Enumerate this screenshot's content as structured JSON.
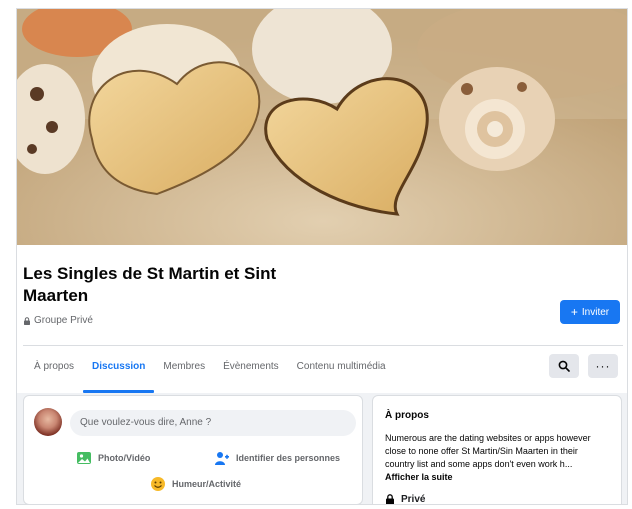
{
  "group": {
    "name": "Les Singles de St Martin et Sint Maarten",
    "privacy": "Groupe Privé",
    "invite_label": "Inviter"
  },
  "tabs": [
    {
      "label": "À propos"
    },
    {
      "label": "Discussion",
      "active": true
    },
    {
      "label": "Membres"
    },
    {
      "label": "Évènements"
    },
    {
      "label": "Contenu multimédia"
    }
  ],
  "more_glyph": "···",
  "composer": {
    "placeholder": "Que voulez-vous dire, Anne ?",
    "actions": {
      "photo": "Photo/Vidéo",
      "tag": "Identifier des personnes",
      "mood": "Humeur/Activité"
    }
  },
  "about": {
    "title": "À propos",
    "description": "Numerous are the dating websites or apps however close to none offer St Martin/Sin Maarten in their country list and some apps don't even work h...",
    "see_more": "Afficher la suite",
    "privacy_label": "Privé"
  },
  "colors": {
    "accent": "#1877f2",
    "page_bg": "#f0f2f5"
  }
}
